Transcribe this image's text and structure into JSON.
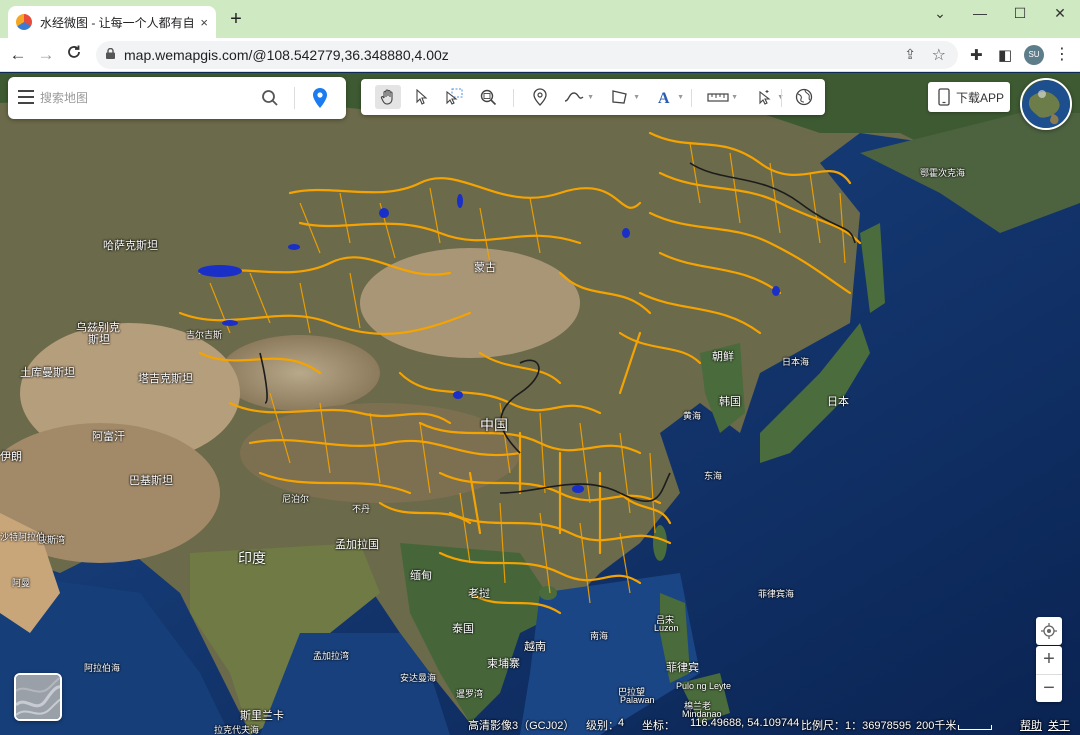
{
  "browser": {
    "tab_title": "水经微图 - 让每一个人都有自己",
    "tab_close": "×",
    "new_tab": "+",
    "url": "map.wemapgis.com/@108.542779,36.348880,4.00z",
    "profile_initials": "SU",
    "window_controls": [
      "⌄",
      "—",
      "☐",
      "✕"
    ],
    "nav": [
      "←",
      "→",
      "C"
    ]
  },
  "search": {
    "placeholder": "搜索地图"
  },
  "toolbar": {
    "tools": [
      "pan-hand-icon",
      "pointer-icon",
      "box-select-icon",
      "zoom-area-icon",
      "marker-icon",
      "polyline-icon",
      "polygon-icon",
      "text-icon",
      "measure-icon",
      "identify-icon",
      "globe-icon"
    ],
    "active": "pan-hand-icon"
  },
  "app_button": {
    "label": "下载APP"
  },
  "map_labels": {
    "kazakhstan": "哈萨克斯坦",
    "uzbekistan_1": "乌兹别克",
    "uzbekistan_2": "斯坦",
    "kyrgyz": "吉尔吉斯",
    "turkmenistan": "土库曼斯坦",
    "tajikistan": "塔吉克斯坦",
    "afghanistan": "阿富汗",
    "iran": "伊朗",
    "pakistan": "巴基斯坦",
    "nepal": "尼泊尔",
    "bhutan": "不丹",
    "india": "印度",
    "bangladesh": "孟加拉国",
    "myanmar": "缅甸",
    "laos": "老挝",
    "thailand": "泰国",
    "vietnam": "越南",
    "cambodia": "柬埔寨",
    "sri_lanka": "斯里兰卡",
    "mongolia": "蒙古",
    "china": "中国",
    "north_korea": "朝鲜",
    "south_korea": "韩国",
    "japan": "日本",
    "sea_of_japan": "日本海",
    "yellow_sea": "黄海",
    "east_sea": "东海",
    "south_sea": "南海",
    "okhotsk": "鄂霍次克海",
    "philippine_sea": "菲律宾海",
    "philippines": "菲律宾",
    "luzon_1": "吕宋",
    "luzon_2": "Luzon",
    "palawan_1": "巴拉望",
    "palawan_2": "Palawan",
    "mindanao_1": "棉兰老",
    "mindanao_2": "Pulo ng Leyte",
    "mindanao_3": "Mindanao",
    "arabian_sea": "阿拉伯海",
    "bay_of_bengal": "孟加拉湾",
    "andaman_sea": "安达曼海",
    "gulf_of_thailand": "暹罗湾",
    "laccadive_sea": "拉克代夫海",
    "persian_gulf": "波斯湾",
    "oman": "阿曼",
    "saudi": "沙特阿拉伯"
  },
  "status": {
    "layer": "高清影像3（GCJ02）",
    "level_label": "级别：",
    "level": "4",
    "coord_label": "坐标：",
    "coord": "116.49688, 54.109744",
    "scale_label": "比例尺：1：36978595",
    "scale_bar": "200千米",
    "help": "帮助",
    "about": "关于"
  },
  "colors": {
    "rivers": "#f5a300",
    "lakes": "#1a2fc8",
    "ocean": "#12356b",
    "tab_bar": "#cfeac2"
  }
}
